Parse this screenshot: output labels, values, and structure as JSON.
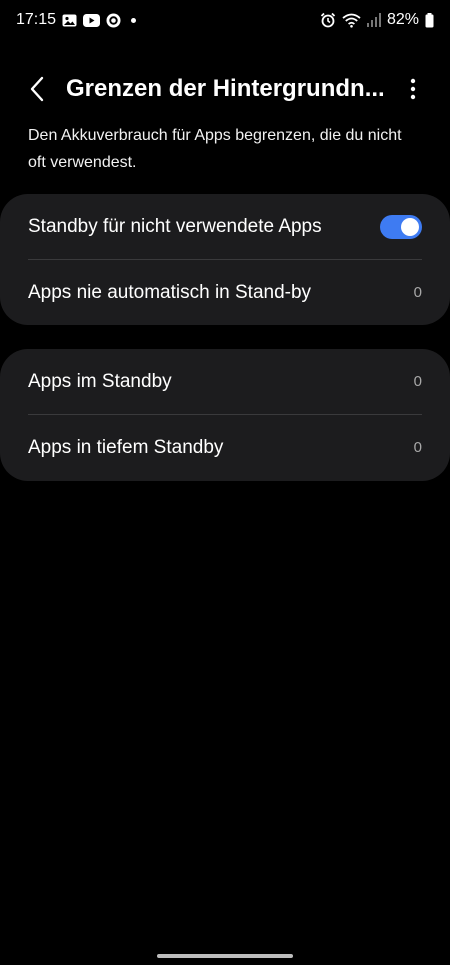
{
  "status_bar": {
    "time": "17:15",
    "battery_percent": "82%",
    "left_icons": [
      "gallery-icon",
      "youtube-icon",
      "circle-app-icon",
      "notification-dot-icon"
    ],
    "right_icons": [
      "alarm-icon",
      "wifi-icon",
      "signal-icon",
      "battery-icon"
    ]
  },
  "header": {
    "title": "Grenzen der Hintergrundn...",
    "back_icon": "back-chevron-icon",
    "more_icon": "more-vertical-icon"
  },
  "description": "Den Akkuverbrauch für Apps begrenzen, die du nicht oft verwendest.",
  "card1": {
    "row1": {
      "label": "Standby für nicht verwendete Apps",
      "toggle_on": true
    },
    "row2": {
      "label": "Apps nie automatisch in Stand-by",
      "count": "0"
    }
  },
  "card2": {
    "row1": {
      "label": "Apps im Standby",
      "count": "0"
    },
    "row2": {
      "label": "Apps in tiefem Standby",
      "count": "0"
    }
  },
  "colors": {
    "background": "#000000",
    "card": "#1c1c1e",
    "accent": "#3e7bf2",
    "divider": "#3a3a3c",
    "secondary_text": "#a8a8a8"
  }
}
